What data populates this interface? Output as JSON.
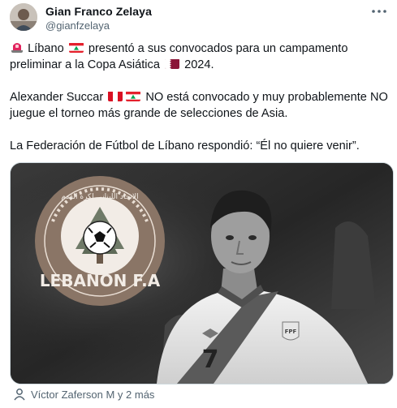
{
  "author": {
    "name": "Gian Franco Zelaya",
    "handle": "@gianfzelaya",
    "avatar_icon": "profile-photo"
  },
  "more_icon": "more-options-icon",
  "tweet": {
    "p1_a": "Líbano",
    "p1_b": "presentó a sus convocados para un campamento",
    "p1_c": "preliminar a la Copa Asiática",
    "p1_d": "2024.",
    "p2_a": "Alexander Succar",
    "p2_b": "NO está convocado y muy probablemente NO",
    "p2_c": "juegue el torneo más grande de selecciones de Asia.",
    "p3": "La Federación de Fútbol de Líbano respondió: “Él no quiere venir”."
  },
  "media": {
    "logo_arc_text": "الاتحاد اللبناني لكرة القدم",
    "logo_text": "LEBANON F.A",
    "jersey_number": "7",
    "badge_text": "FPF"
  },
  "footer": {
    "tagged": "Víctor Zaferson M y 2 más"
  },
  "colors": {
    "text": "#0f1419",
    "secondary": "#536471",
    "logo_brown": "#8a7566",
    "lebanon_red": "#e4202c",
    "cedar_green": "#00a651"
  }
}
